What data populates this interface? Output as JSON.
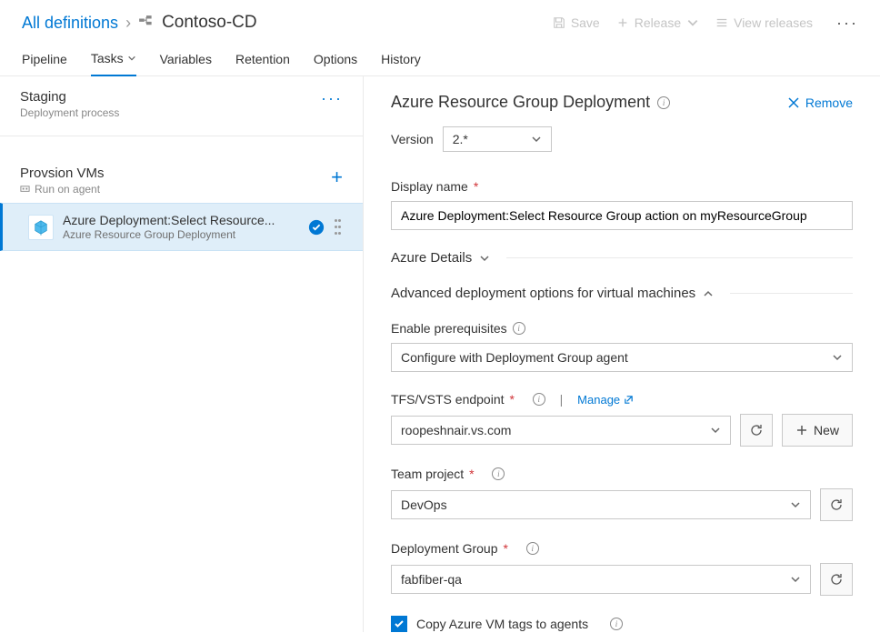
{
  "breadcrumb": {
    "root": "All definitions",
    "title": "Contoso-CD"
  },
  "headerActions": {
    "save": "Save",
    "release": "Release",
    "viewReleases": "View releases"
  },
  "tabs": {
    "pipeline": "Pipeline",
    "tasks": "Tasks",
    "variables": "Variables",
    "retention": "Retention",
    "options": "Options",
    "history": "History"
  },
  "stage": {
    "title": "Staging",
    "subtitle": "Deployment process"
  },
  "phase": {
    "title": "Provsion VMs",
    "subtitle": "Run on agent"
  },
  "task": {
    "title": "Azure Deployment:Select Resource...",
    "subtitle": "Azure Resource Group Deployment"
  },
  "detail": {
    "title": "Azure Resource Group Deployment",
    "remove": "Remove",
    "versionLabel": "Version",
    "versionValue": "2.*",
    "displayNameLabel": "Display name",
    "displayNameValue": "Azure Deployment:Select Resource Group action on myResourceGroup",
    "azureDetailsSection": "Azure Details",
    "advancedSection": "Advanced deployment options for virtual machines",
    "prereqLabel": "Enable prerequisites",
    "prereqValue": "Configure with Deployment Group agent",
    "endpointLabel": "TFS/VSTS endpoint",
    "manageLink": "Manage",
    "endpointValue": "roopeshnair.vs.com",
    "newBtn": "New",
    "teamProjectLabel": "Team project",
    "teamProjectValue": "DevOps",
    "deploymentGroupLabel": "Deployment Group",
    "deploymentGroupValue": "fabfiber-qa",
    "copyTagsLabel": "Copy Azure VM tags to agents"
  }
}
